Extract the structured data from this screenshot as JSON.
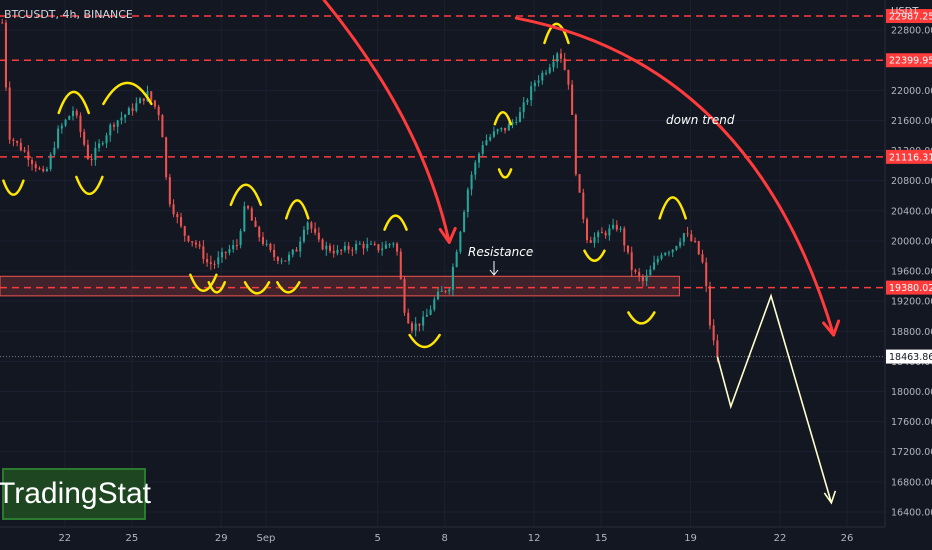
{
  "header": {
    "symbol_line": "BTCUSDT, 4h, BINANCE",
    "currency": "USDT"
  },
  "logo": {
    "text": "TradingStat"
  },
  "colors": {
    "background": "#131722",
    "bull": "#26a69a",
    "bear": "#ef5350",
    "red_line": "#ff3b3b",
    "marker_yellow": "#ffe600",
    "projection": "#ffffcc"
  },
  "chart_data": {
    "type": "candlestick",
    "symbol": "BTCUSDT",
    "timeframe": "4h",
    "exchange": "BINANCE",
    "y_axis": {
      "ticks": [
        16400,
        16800,
        17200,
        17600,
        18000,
        18400,
        18800,
        19200,
        19600,
        20000,
        20400,
        20800,
        21200,
        21600,
        22000,
        22400,
        22800
      ],
      "tick_labels": [
        "16400.00",
        "16800.00",
        "17200.00",
        "17600.00",
        "18000.00",
        "18400.00",
        "18800.00",
        "19200.00",
        "19600.00",
        "20000.00",
        "20400.00",
        "20800.00",
        "21200.00",
        "21600.00",
        "22000.00",
        "22400.00",
        "22800.00"
      ],
      "range": [
        16200,
        23200
      ]
    },
    "x_axis": {
      "days": [
        22,
        25,
        29,
        31,
        36,
        39,
        43,
        46,
        50,
        54,
        57
      ],
      "tick_labels": [
        "22",
        "25",
        "29",
        "Sep",
        "5",
        "8",
        "12",
        "15",
        "19",
        "22",
        "26"
      ],
      "range": [
        19.1,
        58.7
      ]
    },
    "horizontal_levels": [
      {
        "value": 22987.25,
        "label": "22987.25"
      },
      {
        "value": 22399.95,
        "label": "22399.95"
      },
      {
        "value": 21116.31,
        "label": "21116.31"
      },
      {
        "value": 19380.02,
        "label": "19380.02"
      }
    ],
    "current_price": {
      "value": 18463.86,
      "label": "18463.86"
    },
    "resistance_zone": {
      "low": 19270,
      "high": 19530,
      "label": "Resistance"
    },
    "annotations": [
      {
        "text": "down trend"
      },
      {
        "text": "Resistance"
      }
    ],
    "path": [
      [
        19.2,
        22900
      ],
      [
        19.5,
        21400
      ],
      [
        20.3,
        21150
      ],
      [
        21.1,
        20850
      ],
      [
        21.7,
        21450
      ],
      [
        22.4,
        21750
      ],
      [
        23.1,
        21050
      ],
      [
        24.1,
        21550
      ],
      [
        24.8,
        21700
      ],
      [
        25.7,
        21950
      ],
      [
        26.3,
        21650
      ],
      [
        26.6,
        20600
      ],
      [
        27.3,
        20100
      ],
      [
        27.9,
        19950
      ],
      [
        28.4,
        19700
      ],
      [
        28.7,
        19700
      ],
      [
        29.2,
        19850
      ],
      [
        29.7,
        19950
      ],
      [
        30.1,
        20500
      ],
      [
        30.5,
        20150
      ],
      [
        31.3,
        19800
      ],
      [
        31.9,
        19750
      ],
      [
        32.4,
        19900
      ],
      [
        32.8,
        20300
      ],
      [
        33.4,
        19950
      ],
      [
        34.2,
        19850
      ],
      [
        35.2,
        19950
      ],
      [
        36.1,
        19900
      ],
      [
        36.8,
        20000
      ],
      [
        37.2,
        19100
      ],
      [
        37.5,
        18850
      ],
      [
        38.1,
        18950
      ],
      [
        38.6,
        19250
      ],
      [
        39.2,
        19400
      ],
      [
        39.6,
        20000
      ],
      [
        40.1,
        20800
      ],
      [
        40.7,
        21300
      ],
      [
        41.3,
        21450
      ],
      [
        41.8,
        21500
      ],
      [
        42.4,
        21700
      ],
      [
        43.0,
        22100
      ],
      [
        43.6,
        22300
      ],
      [
        44.1,
        22550
      ],
      [
        44.6,
        22050
      ],
      [
        44.9,
        20800
      ],
      [
        45.4,
        20000
      ],
      [
        46.1,
        20100
      ],
      [
        46.8,
        20200
      ],
      [
        47.4,
        19600
      ],
      [
        47.9,
        19450
      ],
      [
        48.7,
        19850
      ],
      [
        49.2,
        19900
      ],
      [
        49.7,
        20100
      ],
      [
        50.2,
        19950
      ],
      [
        50.6,
        19650
      ],
      [
        50.9,
        18800
      ],
      [
        51.2,
        18463
      ]
    ]
  }
}
